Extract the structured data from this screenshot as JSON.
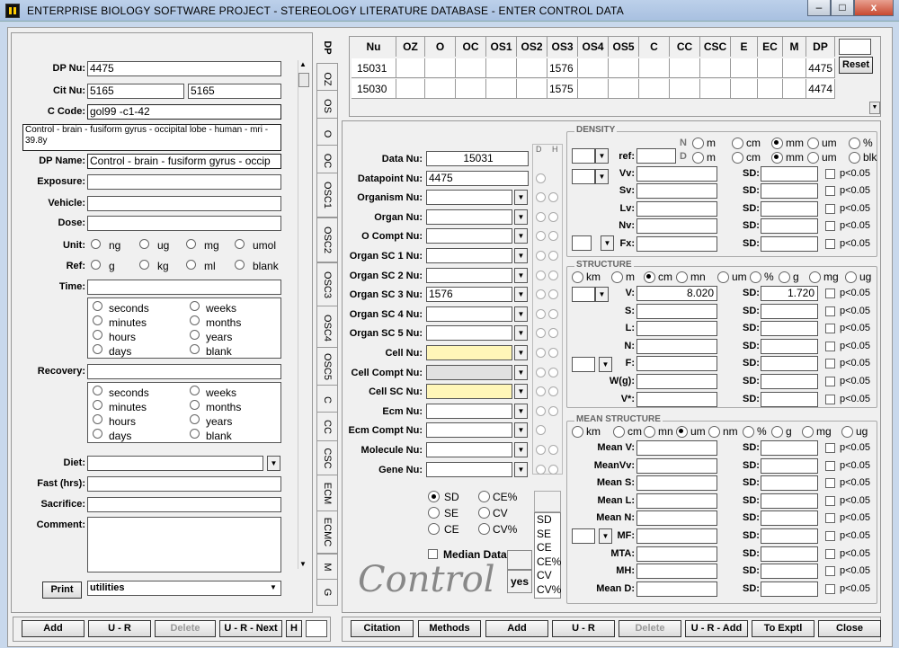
{
  "window": {
    "title": "ENTERPRISE BIOLOGY SOFTWARE PROJECT  -  STEREOLOGY LITERATURE DATABASE  -  ENTER CONTROL DATA",
    "min": "–",
    "max": "□",
    "close": "x"
  },
  "left": {
    "dp_nu_label": "DP Nu:",
    "dp_nu": "4475",
    "cit_nu_label": "Cit Nu:",
    "cit_nu1": "5165",
    "cit_nu2": "5165",
    "c_code_label": "C Code:",
    "c_code": "gol99 -c1-42",
    "description": "Control - brain - fusiform gyrus - occipital lobe - human - mri - 39.8y",
    "dp_name_label": "DP Name:",
    "dp_name": "Control - brain - fusiform gyrus - occip",
    "exposure_label": "Exposure:",
    "vehicle_label": "Vehicle:",
    "dose_label": "Dose:",
    "unit_label": "Unit:",
    "units": [
      "ng",
      "ug",
      "mg",
      "umol"
    ],
    "ref_label": "Ref:",
    "refs": [
      "g",
      "kg",
      "ml",
      "blank"
    ],
    "time_label": "Time:",
    "time_opts": [
      "seconds",
      "minutes",
      "hours",
      "days",
      "weeks",
      "months",
      "years",
      "blank"
    ],
    "recovery_label": "Recovery:",
    "diet_label": "Diet:",
    "fast_label": "Fast (hrs):",
    "sacrifice_label": "Sacrifice:",
    "comment_label": "Comment:",
    "print_label": "Print",
    "utilities": "utilities"
  },
  "tabs": [
    "DP",
    "OZ",
    "OS",
    "O",
    "OC",
    "OSC1",
    "OSC2",
    "OSC3",
    "OSC4",
    "OSC5",
    "C",
    "CC",
    "CSC",
    "ECM",
    "ECMC",
    "M",
    "G"
  ],
  "grid": {
    "headers": [
      "Nu",
      "OZ",
      "O",
      "OC",
      "OS1",
      "OS2",
      "OS3",
      "OS4",
      "OS5",
      "C",
      "CC",
      "CSC",
      "E",
      "EC",
      "M",
      "DP"
    ],
    "rows": [
      {
        "nu": "15031",
        "os3": "1576",
        "dp": "4475"
      },
      {
        "nu": "15030",
        "os3": "1575",
        "dp": "4474"
      }
    ],
    "reset": "Reset"
  },
  "mid": {
    "d_label": "D",
    "h_label": "H",
    "fields": [
      {
        "label": "Data Nu:",
        "value": "15031"
      },
      {
        "label": "Datapoint Nu:",
        "value": "4475"
      },
      {
        "label": "Organism Nu:",
        "value": ""
      },
      {
        "label": "Organ Nu:",
        "value": ""
      },
      {
        "label": "O Compt Nu:",
        "value": ""
      },
      {
        "label": "Organ SC 1 Nu:",
        "value": ""
      },
      {
        "label": "Organ SC 2 Nu:",
        "value": ""
      },
      {
        "label": "Organ SC 3 Nu:",
        "value": "1576"
      },
      {
        "label": "Organ SC 4 Nu:",
        "value": ""
      },
      {
        "label": "Organ SC 5 Nu:",
        "value": ""
      },
      {
        "label": "Cell Nu:",
        "value": ""
      },
      {
        "label": "Cell Compt Nu:",
        "value": ""
      },
      {
        "label": "Cell SC Nu:",
        "value": ""
      },
      {
        "label": "Ecm Nu:",
        "value": ""
      },
      {
        "label": "Ecm Compt Nu:",
        "value": ""
      },
      {
        "label": "Molecule Nu:",
        "value": ""
      },
      {
        "label": "Gene Nu:",
        "value": ""
      }
    ],
    "stat_opts": [
      "SD",
      "SE",
      "CE",
      "CE%",
      "CV",
      "CV%"
    ],
    "stat_list": [
      "SD",
      "SE",
      "CE",
      "CE%",
      "CV",
      "CV%"
    ],
    "median_label": "Median Data",
    "yes": "yes",
    "watermark": "Control"
  },
  "density": {
    "title": "DENSITY",
    "n": "N",
    "d": "D",
    "units": [
      "m",
      "cm",
      "mm",
      "um",
      "%"
    ],
    "units2": [
      "m",
      "cm",
      "mm",
      "um",
      "blk"
    ],
    "ref_label": "ref:",
    "rows": [
      "Vv:",
      "Sv:",
      "Lv:",
      "Nv:",
      "Fx:"
    ],
    "sd": "SD:",
    "p": "p<0.05"
  },
  "structure": {
    "title": "STRUCTURE",
    "units": [
      "km",
      "m",
      "cm",
      "mn",
      "um",
      "%",
      "g",
      "mg",
      "ug"
    ],
    "rows": [
      "V:",
      "S:",
      "L:",
      "N:",
      "F:",
      "W(g):",
      "V*:"
    ],
    "v_value": "8.020",
    "v_sd": "1.720",
    "sd": "SD:",
    "p": "p<0.05"
  },
  "mean_structure": {
    "title": "MEAN STRUCTURE",
    "units": [
      "km",
      "cm",
      "mn",
      "um",
      "nm",
      "%",
      "g",
      "mg",
      "ug"
    ],
    "rows": [
      "Mean V:",
      "MeanVv:",
      "Mean S:",
      "Mean L:",
      "Mean N:",
      "MF:",
      "MTA:",
      "MH:",
      "Mean D:"
    ],
    "sd": "SD:",
    "p": "p<0.05"
  },
  "bottom_left": {
    "add": "Add",
    "ur": "U - R",
    "delete": "Delete",
    "ur_next": "U - R - Next",
    "h": "H"
  },
  "bottom_right": {
    "citation": "Citation",
    "methods": "Methods",
    "add": "Add",
    "ur": "U - R",
    "delete": "Delete",
    "ur_add": "U - R - Add",
    "to_exptl": "To Exptl",
    "close": "Close"
  }
}
